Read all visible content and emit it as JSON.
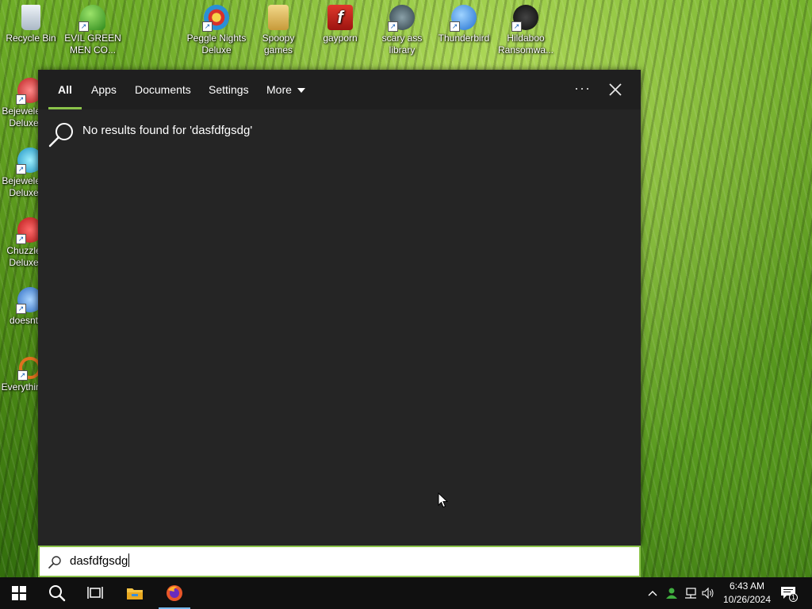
{
  "desktop": {
    "icons_top": [
      {
        "label": "Recycle Bin",
        "color": "#c9d6e3"
      },
      {
        "label": "EVIL GREEN MEN CO...",
        "color": "#5fbf3a"
      },
      {
        "label": "Peggle Nights Deluxe",
        "color": "#3a9ad9"
      },
      {
        "label": "Spoopy games",
        "color": "#e8c070"
      },
      {
        "label": "gayporn",
        "color": "#c8201a"
      },
      {
        "label": "scary ass library",
        "color": "#4f6b7a"
      },
      {
        "label": "Thunderbird",
        "color": "#1f7ad6"
      },
      {
        "label": "Hildaboo Ransomwa...",
        "color": "#1a1a1a"
      }
    ],
    "icons_left": [
      {
        "label": "Bejeweled Deluxe",
        "color": "#c93a3a"
      },
      {
        "label": "Bejeweled Deluxe",
        "color": "#2aa3d8"
      },
      {
        "label": "Chuzzle Deluxe",
        "color": "#d83030"
      },
      {
        "label": "doesnt",
        "color": "#3b7fd0"
      },
      {
        "label": "Everything",
        "color": "#e07020"
      }
    ]
  },
  "search": {
    "tabs": [
      "All",
      "Apps",
      "Documents",
      "Settings",
      "More"
    ],
    "active_tab": "All",
    "more_menu_icon": "ellipsis-icon",
    "close_icon": "close-icon",
    "result_message": "No results found for 'dasfdfgsdg'",
    "query": "dasfdfgsdg",
    "accent_color": "#8bc34a"
  },
  "taskbar": {
    "buttons": [
      "start-icon",
      "search-icon",
      "task-view-icon",
      "file-explorer-icon",
      "firefox-icon"
    ],
    "tray_icons": [
      "chevron-up-icon",
      "people-icon",
      "network-icon",
      "volume-icon"
    ],
    "time": "6:43 AM",
    "date": "10/26/2024",
    "notification_count": "1"
  }
}
